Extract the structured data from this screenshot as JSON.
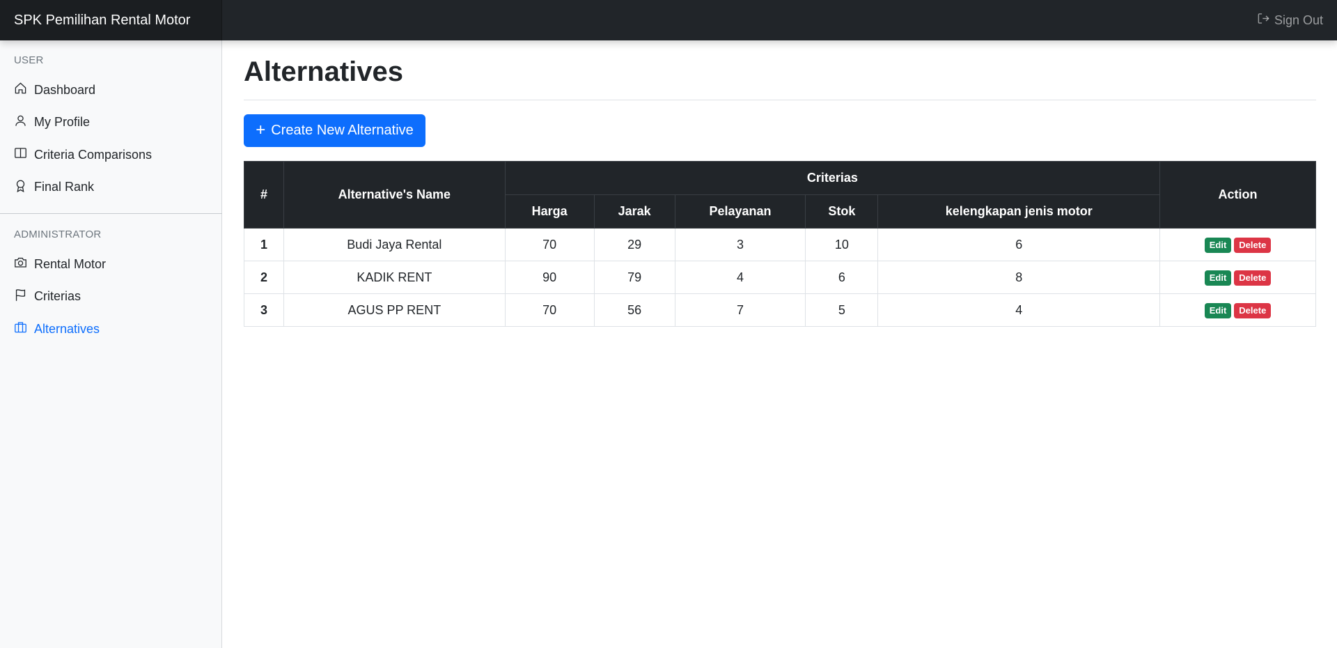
{
  "navbar": {
    "brand": "SPK Pemilihan Rental Motor",
    "sign_out": "Sign Out"
  },
  "sidebar": {
    "user_heading": "USER",
    "user_items": [
      {
        "label": "Dashboard",
        "icon": "house-icon"
      },
      {
        "label": "My Profile",
        "icon": "person-icon"
      },
      {
        "label": "Criteria Comparisons",
        "icon": "layout-split-icon"
      },
      {
        "label": "Final Rank",
        "icon": "award-icon"
      }
    ],
    "admin_heading": "ADMINISTRATOR",
    "admin_items": [
      {
        "label": "Rental Motor",
        "icon": "camera-icon"
      },
      {
        "label": "Criterias",
        "icon": "flag-icon"
      },
      {
        "label": "Alternatives",
        "icon": "briefcase-icon",
        "active": true
      }
    ],
    "active_color": "#0d6efd"
  },
  "main": {
    "title": "Alternatives",
    "create_button": "Create New Alternative",
    "table": {
      "headers": {
        "number": "#",
        "name": "Alternative's Name",
        "criterias": "Criterias",
        "criteria_columns": [
          "Harga",
          "Jarak",
          "Pelayanan",
          "Stok",
          "kelengkapan jenis motor"
        ],
        "action": "Action"
      },
      "rows": [
        {
          "no": "1",
          "name": "Budi Jaya Rental",
          "values": [
            "70",
            "29",
            "3",
            "10",
            "6"
          ]
        },
        {
          "no": "2",
          "name": "KADIK RENT",
          "values": [
            "90",
            "79",
            "4",
            "6",
            "8"
          ]
        },
        {
          "no": "3",
          "name": "AGUS PP RENT",
          "values": [
            "70",
            "56",
            "7",
            "5",
            "4"
          ]
        }
      ],
      "edit_label": "Edit",
      "delete_label": "Delete"
    }
  },
  "colors": {
    "navbar": "#212529",
    "primary": "#0d6efd",
    "success": "#198754",
    "danger": "#dc3545"
  }
}
